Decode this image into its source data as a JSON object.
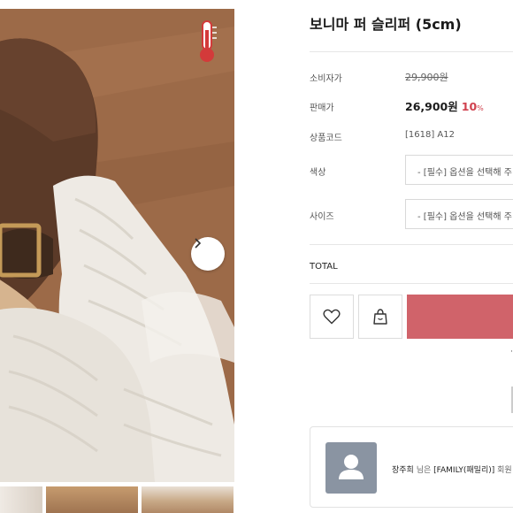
{
  "product": {
    "title": "보니마 퍼 슬리퍼 (5cm)"
  },
  "info": {
    "consumer_price_label": "소비자가",
    "consumer_price": "29,900원",
    "sale_price_label": "판매가",
    "sale_price": "26,900원",
    "discount": "10",
    "discount_unit": "%",
    "product_code_label": "상품코드",
    "product_code": "[1618] A12"
  },
  "options": {
    "color_label": "색상",
    "color_placeholder": "- [필수] 옵션을 선택해 주",
    "size_label": "사이즈",
    "size_placeholder": "- [필수] 옵션을 선택해 주"
  },
  "total": {
    "label": "TOTAL"
  },
  "actions": {
    "wishlist_icon": "heart-icon",
    "cart_icon": "shopping-bag-icon",
    "buy_color": "#d0636a"
  },
  "review": {
    "name": "장주희",
    "middle": " 님은 ",
    "group": "[FAMILY(패밀리)]",
    "trail": " 회원"
  },
  "colors": {
    "accent": "#d0414e",
    "buy_button": "#d0636a",
    "avatar": "#8a94a2"
  }
}
